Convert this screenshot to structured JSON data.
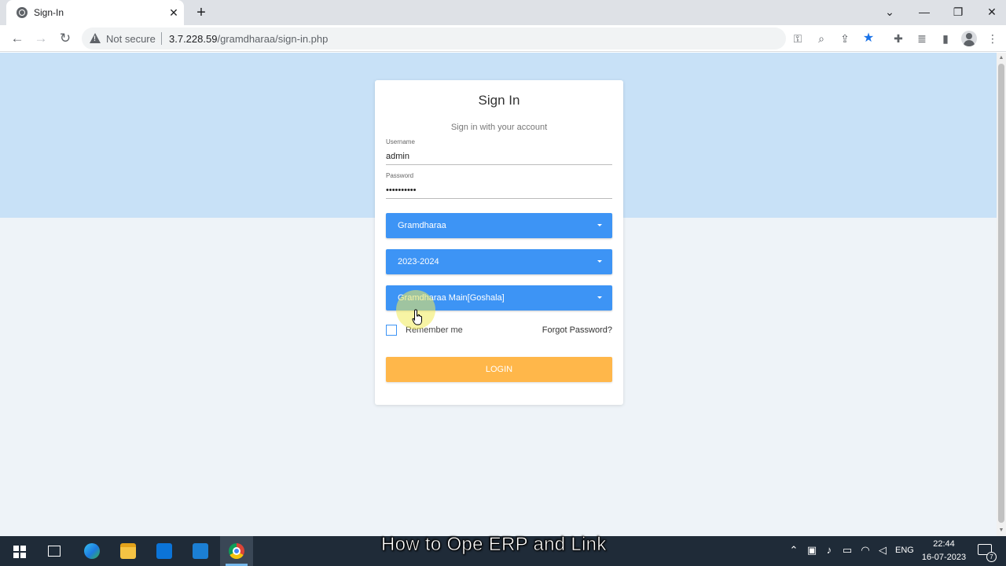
{
  "browser": {
    "tab_title": "Sign-In",
    "tab_close": "✕",
    "new_tab": "+",
    "security_label": "Not secure",
    "url_host": "3.7.228.59",
    "url_path": "/gramdharaa/sign-in.php",
    "accent_color": "#1a73e8"
  },
  "signin": {
    "title": "Sign In",
    "subtitle": "Sign in with your account",
    "username_label": "Username",
    "username_value": "admin",
    "password_label": "Password",
    "password_value": "••••••••••",
    "company_select": "Gramdharaa",
    "year_select": "2023-2024",
    "branch_select": "Gramdharaa Main[Goshala]",
    "remember_label": "Remember me",
    "forgot_label": "Forgot Password?",
    "login_label": "LOGIN",
    "select_color": "#3d94f5",
    "login_color": "#ffb74a"
  },
  "caption": "How to Ope ERP and Link",
  "taskbar": {
    "language": "ENG",
    "time": "22:44",
    "date": "16-07-2023",
    "notification_count": "7"
  }
}
